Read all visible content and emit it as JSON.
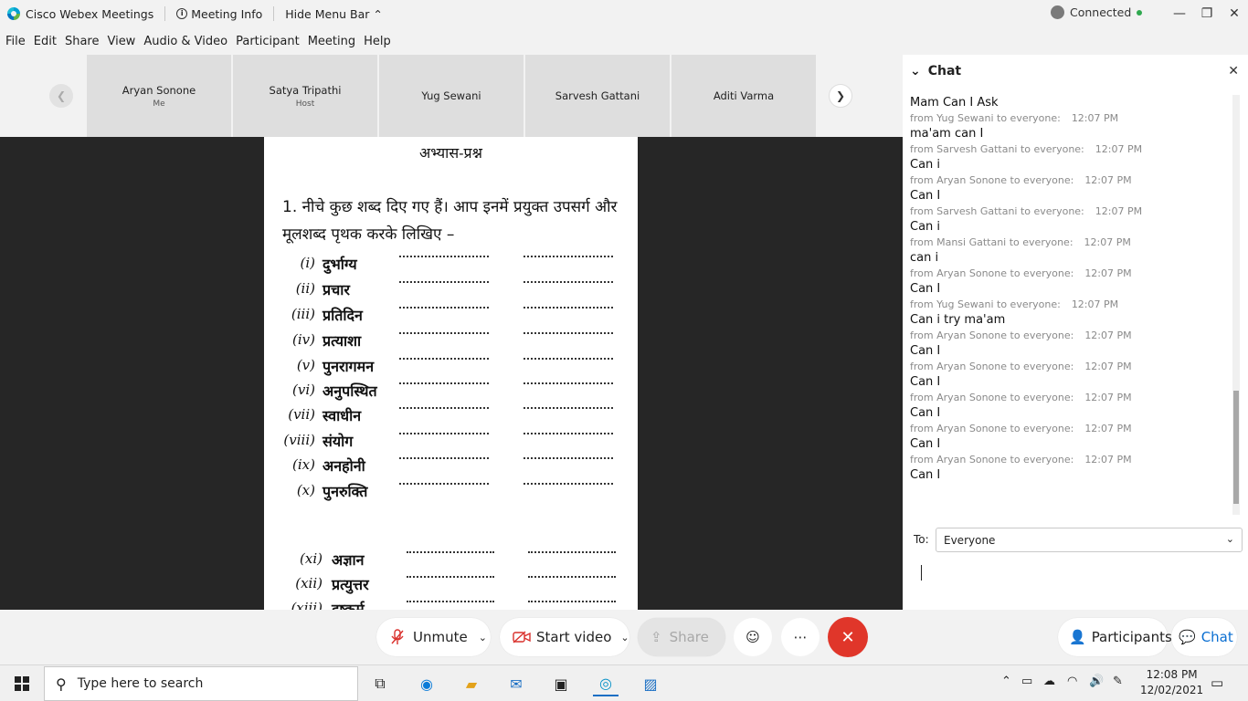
{
  "titlebar": {
    "app_name": "Cisco Webex Meetings",
    "meeting_info": "Meeting Info",
    "hide_menu_bar": "Hide Menu Bar",
    "status": "Connected",
    "colors": {
      "status_ok": "#2fa84f"
    }
  },
  "menu": [
    "File",
    "Edit",
    "Share",
    "View",
    "Audio & Video",
    "Participant",
    "Meeting",
    "Help"
  ],
  "participants": [
    {
      "name": "Aryan Sonone",
      "role": "Me"
    },
    {
      "name": "Satya Tripathi",
      "role": "Host"
    },
    {
      "name": "Yug Sewani",
      "role": ""
    },
    {
      "name": "Sarvesh Gattani",
      "role": ""
    },
    {
      "name": "Aditi Varma",
      "role": ""
    }
  ],
  "document": {
    "heading": "अभ्यास-प्रश्न",
    "question": "1. नीचे कुछ शब्द दिए गए हैं। आप इनमें प्रयुक्त उपसर्ग और मूलशब्द पृथक करके लिखिए –",
    "items": [
      {
        "num": "(i)",
        "word": "दुर्भाग्य"
      },
      {
        "num": "(ii)",
        "word": "प्रचार"
      },
      {
        "num": "(iii)",
        "word": "प्रतिदिन"
      },
      {
        "num": "(iv)",
        "word": "प्रत्याशा"
      },
      {
        "num": "(v)",
        "word": "पुनरागमन"
      },
      {
        "num": "(vi)",
        "word": "अनुपस्थित"
      },
      {
        "num": "(vii)",
        "word": "स्वाधीन"
      },
      {
        "num": "(viii)",
        "word": "संयोग"
      },
      {
        "num": "(ix)",
        "word": "अनहोनी"
      },
      {
        "num": "(x)",
        "word": "पुनरुक्ति"
      },
      {
        "num": "(xi)",
        "word": "अज्ञान"
      },
      {
        "num": "(xii)",
        "word": "प्रत्युत्तर"
      },
      {
        "num": "(xiii)",
        "word": "दुष्कर्म"
      }
    ]
  },
  "chat": {
    "title": "Chat",
    "messages": [
      {
        "text": "Mam Can I Ask",
        "meta": "from Yug Sewani to everyone:",
        "time": "12:07 PM"
      },
      {
        "text": "ma'am can I",
        "meta": "from Sarvesh Gattani to everyone:",
        "time": "12:07 PM"
      },
      {
        "text": "Can i",
        "meta": "from Aryan Sonone to everyone:",
        "time": "12:07 PM"
      },
      {
        "text": "Can I",
        "meta": "from Sarvesh Gattani to everyone:",
        "time": "12:07 PM"
      },
      {
        "text": "Can i",
        "meta": "from Mansi Gattani to everyone:",
        "time": "12:07 PM"
      },
      {
        "text": "can i",
        "meta": "from Aryan Sonone to everyone:",
        "time": "12:07 PM"
      },
      {
        "text": "Can I",
        "meta": "from Yug Sewani to everyone:",
        "time": "12:07 PM"
      },
      {
        "text": "Can i try ma'am",
        "meta": "from Aryan Sonone to everyone:",
        "time": "12:07 PM"
      },
      {
        "text": "Can I",
        "meta": "from Aryan Sonone to everyone:",
        "time": "12:07 PM"
      },
      {
        "text": "Can I",
        "meta": "from Aryan Sonone to everyone:",
        "time": "12:07 PM"
      },
      {
        "text": "Can I",
        "meta": "from Aryan Sonone to everyone:",
        "time": "12:07 PM"
      },
      {
        "text": "Can I",
        "meta": "from Aryan Sonone to everyone:",
        "time": "12:07 PM"
      },
      {
        "text": "Can I",
        "meta": null,
        "time": null
      }
    ],
    "to_label": "To:",
    "to_value": "Everyone"
  },
  "controls": {
    "unmute": "Unmute",
    "start_video": "Start video",
    "share": "Share",
    "participants": "Participants",
    "chat": "Chat",
    "colors": {
      "end_call": "#e0362a",
      "accent": "#0a6ed1",
      "mute_icon": "#d9302c"
    }
  },
  "taskbar": {
    "search_placeholder": "Type here to search",
    "time": "12:08 PM",
    "date": "12/02/2021"
  }
}
